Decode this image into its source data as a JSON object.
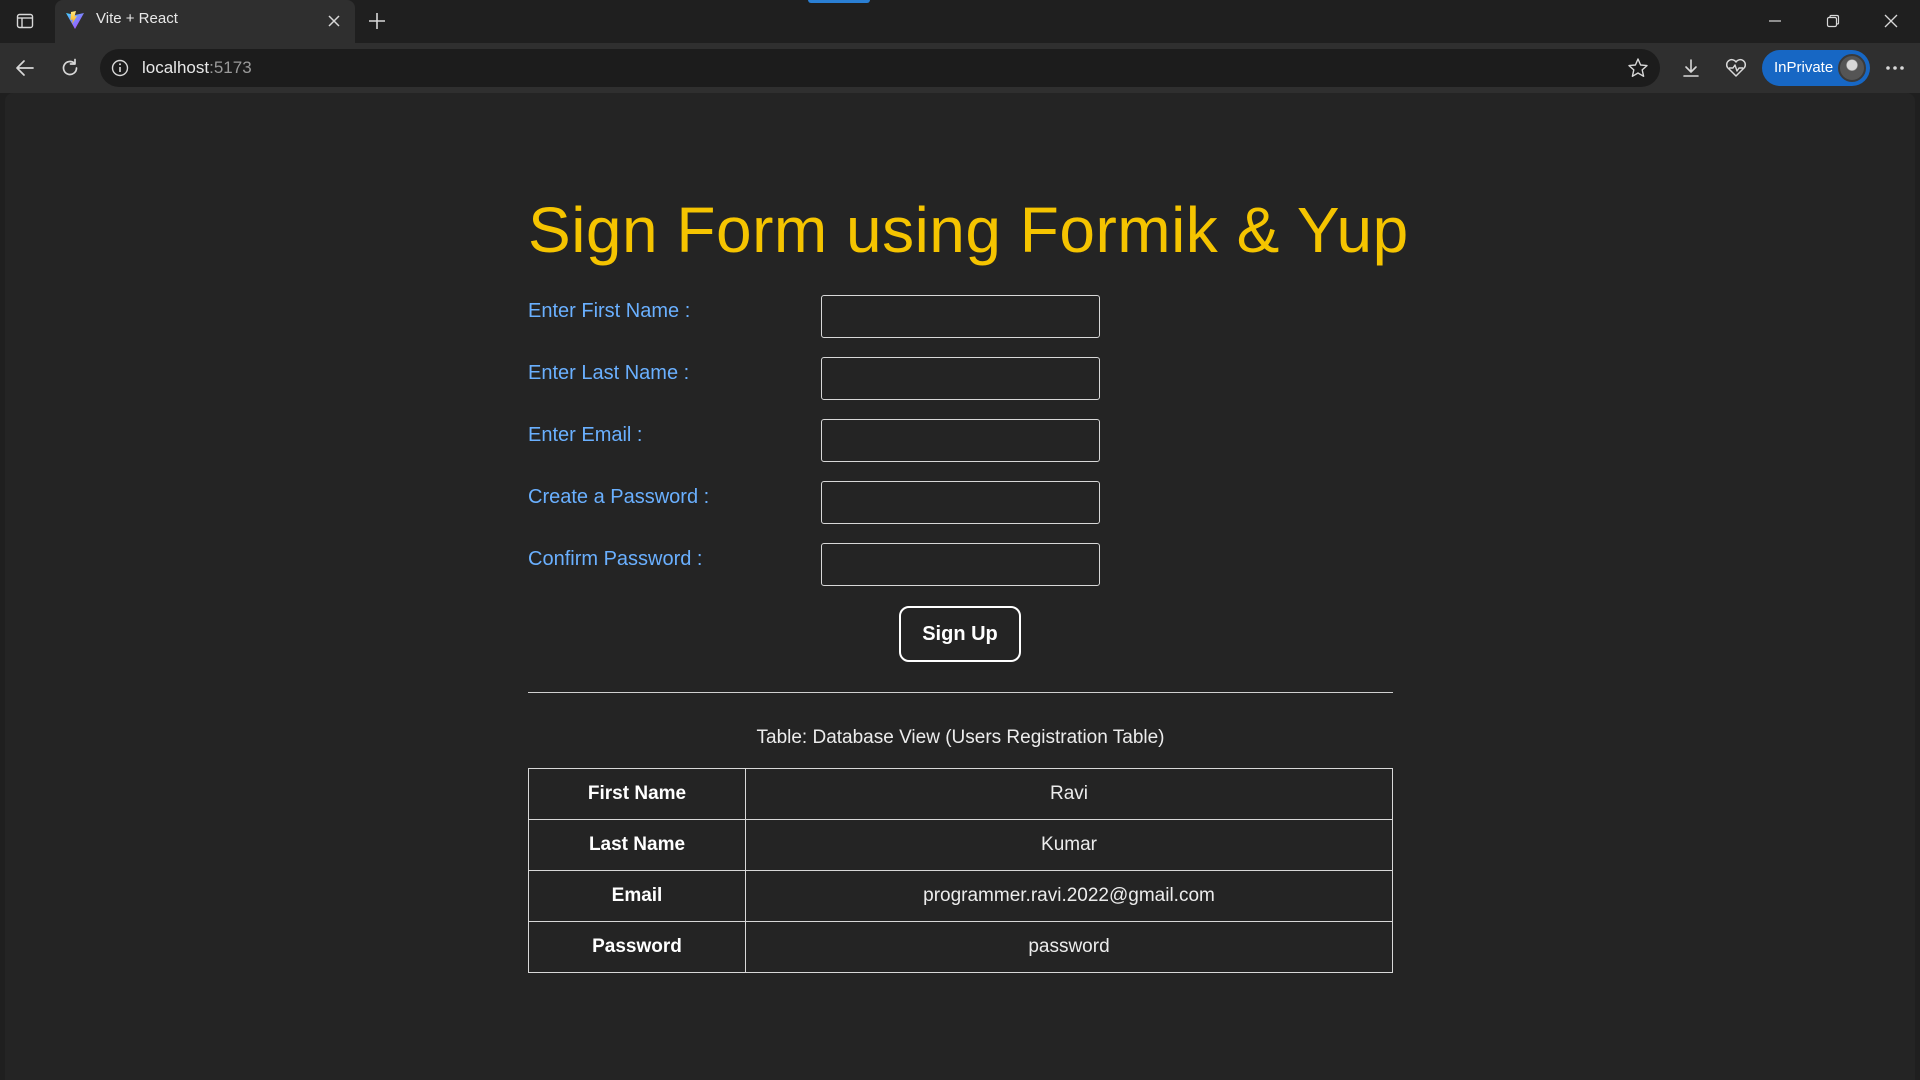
{
  "browser": {
    "tab_title": "Vite + React",
    "url_host": "localhost",
    "url_port": ":5173",
    "inprivate_label": "InPrivate"
  },
  "page": {
    "title": "Sign Form using Formik & Yup",
    "fields": [
      {
        "label": "Enter First Name :",
        "value": ""
      },
      {
        "label": "Enter Last Name :",
        "value": ""
      },
      {
        "label": "Enter Email :",
        "value": ""
      },
      {
        "label": "Create a Password :",
        "value": ""
      },
      {
        "label": "Confirm Password :",
        "value": ""
      }
    ],
    "submit_label": "Sign Up",
    "table_caption": "Table: Database View (Users Registration Table)",
    "table_rows": [
      {
        "field": "First Name",
        "value": "Ravi"
      },
      {
        "field": "Last Name",
        "value": "Kumar"
      },
      {
        "field": "Email",
        "value": "programmer.ravi.2022@gmail.com"
      },
      {
        "field": "Password",
        "value": "password"
      }
    ]
  },
  "colors": {
    "title": "#f5c400",
    "label": "#6ab0ff",
    "page_bg": "#242424",
    "inprivate_bg": "#1767c4"
  }
}
